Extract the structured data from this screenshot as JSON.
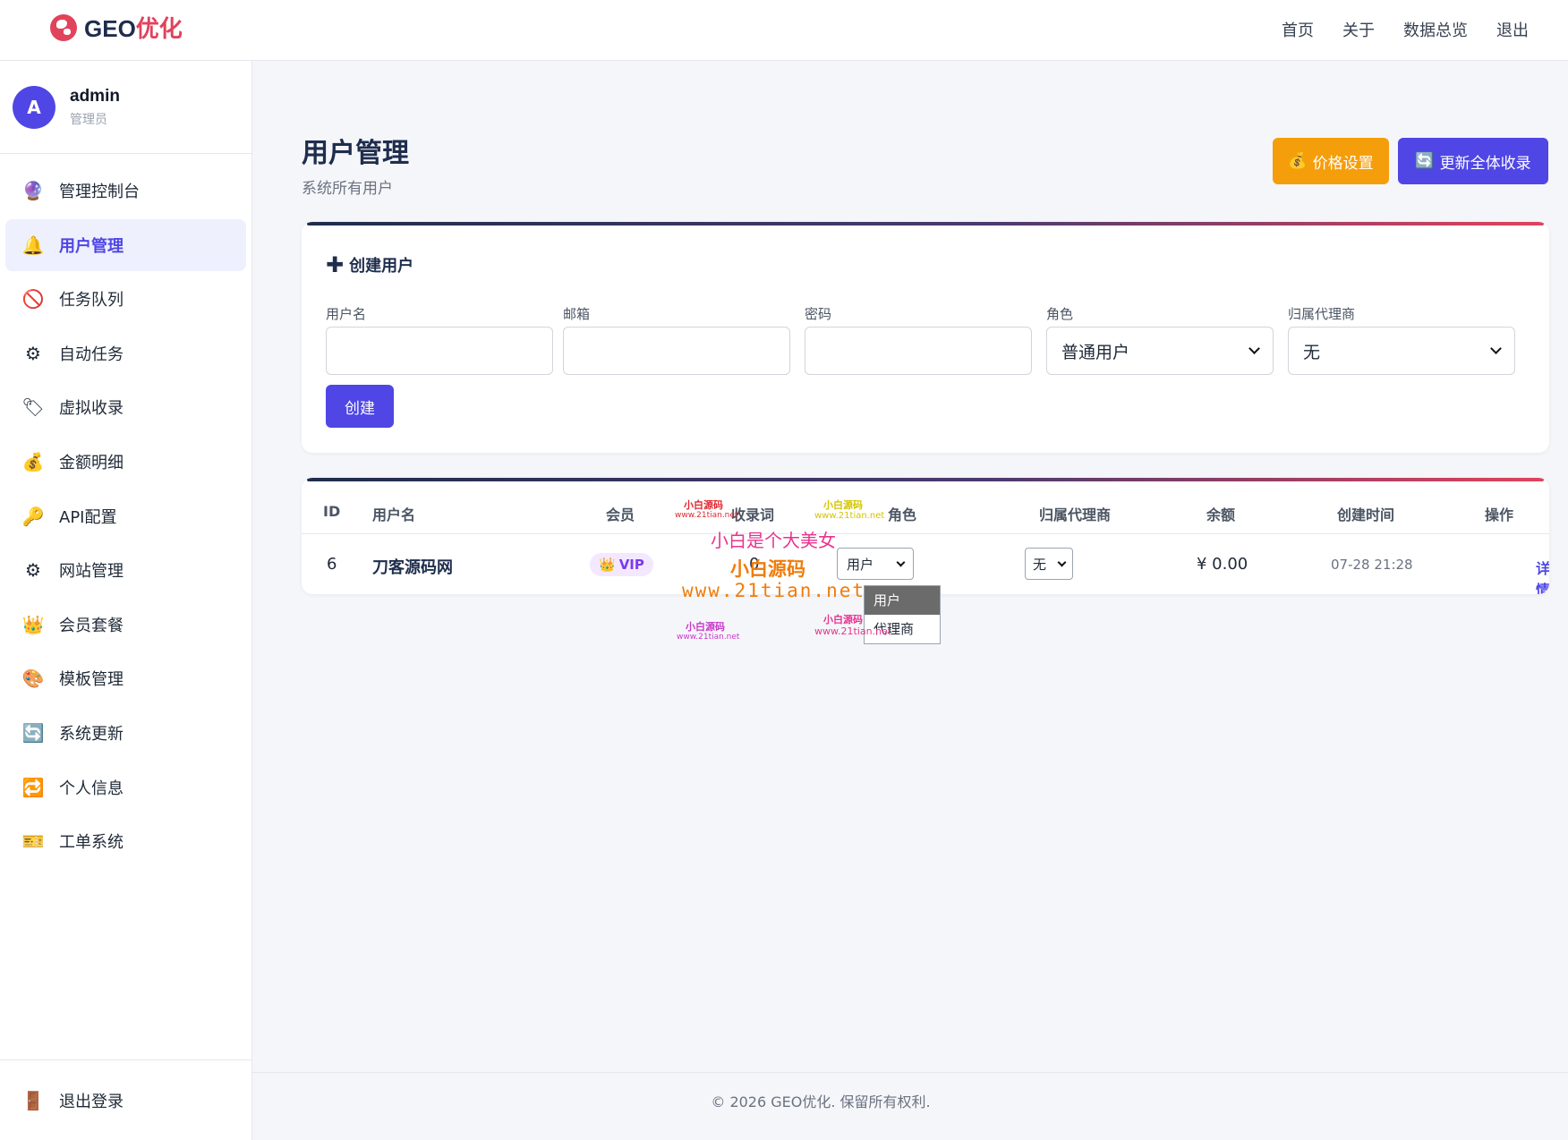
{
  "brand": {
    "logo_text_main": "GEO",
    "logo_text_accent": "优化"
  },
  "topnav": [
    "首页",
    "关于",
    "数据总览",
    "退出"
  ],
  "user": {
    "avatar_initial": "A",
    "name": "admin",
    "role": "管理员"
  },
  "sidebar": {
    "items": [
      {
        "icon": "🔮",
        "label": "管理控制台"
      },
      {
        "icon": "🔔",
        "label": "用户管理"
      },
      {
        "icon": "🚫",
        "label": "任务队列"
      },
      {
        "icon": "⚙",
        "label": "自动任务"
      },
      {
        "icon": "🏷",
        "label": "虚拟收录"
      },
      {
        "icon": "💰",
        "label": "金额明细"
      },
      {
        "icon": "🔑",
        "label": "API配置"
      },
      {
        "icon": "⚙",
        "label": "网站管理"
      },
      {
        "icon": "👑",
        "label": "会员套餐"
      },
      {
        "icon": "🎨",
        "label": "模板管理"
      },
      {
        "icon": "🔄",
        "label": "系统更新"
      },
      {
        "icon": "🔁",
        "label": "个人信息"
      },
      {
        "icon": "🎫",
        "label": "工单系统"
      }
    ],
    "active_index": 1,
    "logout": {
      "icon": "🚪",
      "label": "退出登录"
    }
  },
  "page": {
    "title": "用户管理",
    "subtitle": "系统所有用户",
    "price_button": "价格设置",
    "price_icon": "💰",
    "update_button": "更新全体收录",
    "update_icon": "🔄"
  },
  "create_form": {
    "title": "创建用户",
    "fields": {
      "username": {
        "label": "用户名",
        "value": ""
      },
      "email": {
        "label": "邮箱",
        "value": ""
      },
      "password": {
        "label": "密码",
        "value": ""
      },
      "role": {
        "label": "角色",
        "selected": "普通用户"
      },
      "agent": {
        "label": "归属代理商",
        "selected": "无"
      }
    },
    "submit": "创建"
  },
  "table": {
    "headers": [
      "ID",
      "用户名",
      "会员",
      "收录词",
      "角色",
      "归属代理商",
      "余额",
      "创建时间",
      "操作"
    ],
    "rows": [
      {
        "id": "6",
        "username": "刀客源码网",
        "member": "VIP",
        "member_icon": "👑",
        "keywords": "0",
        "role": "用户",
        "agent": "无",
        "balance": "¥ 0.00",
        "created": "07-28 21:28",
        "action": "详情"
      }
    ]
  },
  "role_dropdown": {
    "options": [
      "用户",
      "代理商"
    ],
    "highlighted": "用户"
  },
  "footer": "© 2026 GEO优化. 保留所有权利.",
  "watermark": {
    "lines": [
      "小白是个大美女",
      "小白源码",
      "www.21tian.net"
    ],
    "small_a": "小白源码",
    "small_b": "www.21tian.net",
    "colors": {
      "pink": "#e8338f",
      "orange": "#f07c0a",
      "magenta": "#c838c8",
      "yellow": "#d4c400",
      "red": "#e0272f"
    }
  },
  "colors": {
    "primary": "#4f46e5",
    "warning": "#f59e0b",
    "brand_red": "#e0435c",
    "navy": "#1f2d4d"
  }
}
